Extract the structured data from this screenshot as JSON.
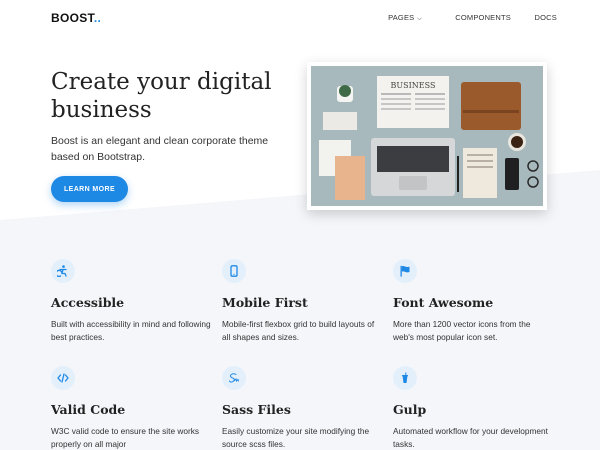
{
  "navbar": {
    "brand": "BOOST",
    "brand_dots": "..",
    "links": [
      {
        "label": "PAGES",
        "has_dropdown": true
      },
      {
        "label": "COMPONENTS"
      },
      {
        "label": "DOCS"
      }
    ]
  },
  "hero": {
    "title": "Create your digital business",
    "subtitle": "Boost is an elegant and clean corporate theme based on Bootstrap.",
    "cta": "LEARN MORE",
    "image_alt": "Desk with laptop, newspaper, notebooks and coffee",
    "newspaper_heading": "BUSINESS"
  },
  "features": [
    {
      "icon": "accessibility-icon",
      "title": "Accessible",
      "text": "Built with accessibility in mind and following best practices."
    },
    {
      "icon": "mobile-icon",
      "title": "Mobile First",
      "text": "Mobile-first flexbox grid to build layouts of all shapes and sizes."
    },
    {
      "icon": "flag-icon",
      "title": "Font Awesome",
      "text": "More than 1200 vector icons from the web's most popular icon set."
    },
    {
      "icon": "code-icon",
      "title": "Valid Code",
      "text": "W3C valid code to ensure the site works properly on all major"
    },
    {
      "icon": "sass-icon",
      "title": "Sass Files",
      "text": "Easily customize your site modifying the source scss files."
    },
    {
      "icon": "gulp-icon",
      "title": "Gulp",
      "text": "Automated workflow for your development tasks."
    }
  ],
  "colors": {
    "accent": "#1e88e5",
    "icon_bg": "#e3f0fc",
    "section_bg": "#f5f6fa"
  }
}
